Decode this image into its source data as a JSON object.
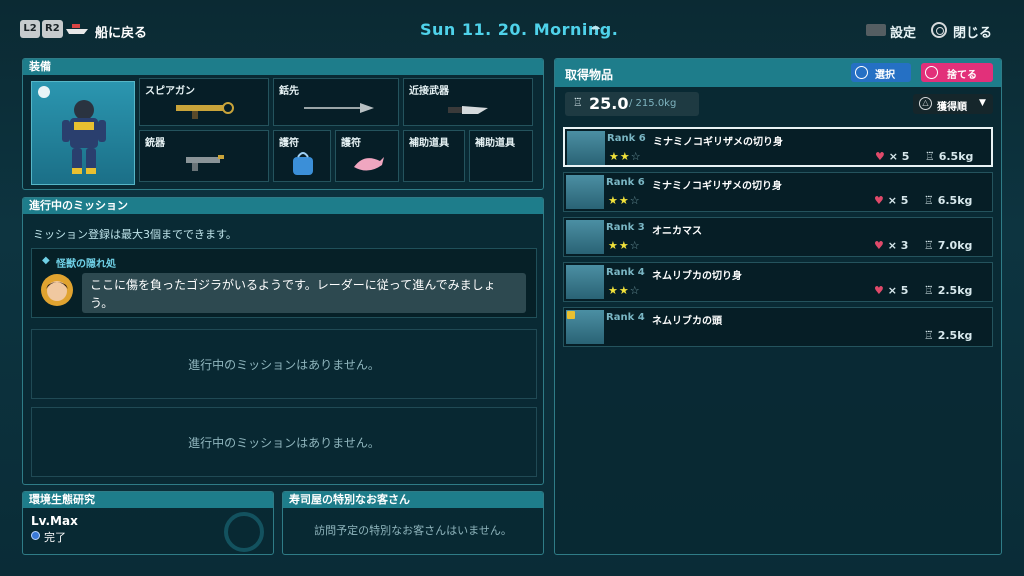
{
  "topbar": {
    "l2": "L2",
    "r2": "R2",
    "back_label": "船に戻る",
    "date": "Sun 11. 20. Morning.",
    "settings_label": "設定",
    "close_label": "閉じる"
  },
  "equipment": {
    "title": "装備",
    "slots": [
      "スピアガン",
      "銛先",
      "近接武器",
      "銃器",
      "護符",
      "護符",
      "補助道具",
      "補助道具"
    ]
  },
  "missions": {
    "title": "進行中のミッション",
    "note": "ミッション登録は最大3個までできます。",
    "card_title": "怪獣の隠れ処",
    "card_text_line1": "ここに傷を負ったゴジラがいるようです。レーダーに従って進んでみましょ",
    "card_text_line2": "う。",
    "empty1": "進行中のミッションはありません。",
    "empty2": "進行中のミッションはありません。"
  },
  "eco": {
    "title": "環境生態研究",
    "level": "Lv.Max",
    "status": "完了"
  },
  "sushi": {
    "title": "寿司屋の特別なお客さん",
    "text": "訪問予定の特別なお客さんはいません。"
  },
  "loot": {
    "title": "取得物品",
    "select_label": "選択",
    "discard_label": "捨てる",
    "weight_current": "25.0",
    "weight_max": "/ 215.0kg",
    "sort_label": "獲得順",
    "items": [
      {
        "rank": "Rank 6",
        "name": "ミナミノコギリザメの切り身",
        "stars": "★★",
        "stars_empty": "☆",
        "count": "× 5",
        "weight": "6.5kg"
      },
      {
        "rank": "Rank 6",
        "name": "ミナミノコギリザメの切り身",
        "stars": "★★",
        "stars_empty": "☆",
        "count": "× 5",
        "weight": "6.5kg"
      },
      {
        "rank": "Rank 3",
        "name": "オニカマス",
        "stars": "★★",
        "stars_empty": "☆",
        "count": "× 3",
        "weight": "7.0kg"
      },
      {
        "rank": "Rank 4",
        "name": "ネムリブカの切り身",
        "stars": "★★",
        "stars_empty": "☆",
        "count": "× 5",
        "weight": "2.5kg"
      },
      {
        "rank": "Rank 4",
        "name": "ネムリブカの頭",
        "stars": "",
        "stars_empty": "",
        "count": "",
        "weight": "2.5kg"
      }
    ]
  }
}
